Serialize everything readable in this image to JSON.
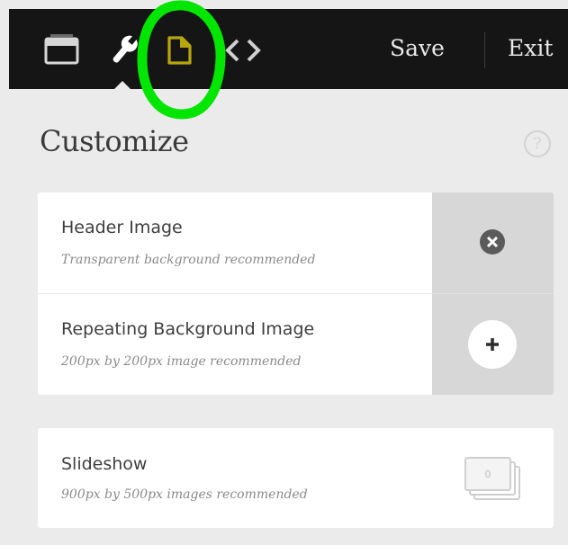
{
  "toolbar": {
    "icons": [
      "window-icon",
      "wrench-icon",
      "page-icon",
      "code-icon"
    ],
    "save_label": "Save",
    "exit_label": "Exit",
    "accent": "#b8a60d",
    "highlight_color": "#00e600"
  },
  "panel": {
    "title": "Customize",
    "help_label": "?"
  },
  "images_card": {
    "rows": [
      {
        "label": "Header Image",
        "hint": "Transparent background recommended",
        "action_icon": "remove-icon"
      },
      {
        "label": "Repeating Background Image",
        "hint": "200px by 200px image recommended",
        "action_icon": "add-icon"
      }
    ]
  },
  "slideshow_card": {
    "label": "Slideshow",
    "hint": "900px by 500px images recommended",
    "icon": "slideshow-stack-icon",
    "badge": "0"
  }
}
